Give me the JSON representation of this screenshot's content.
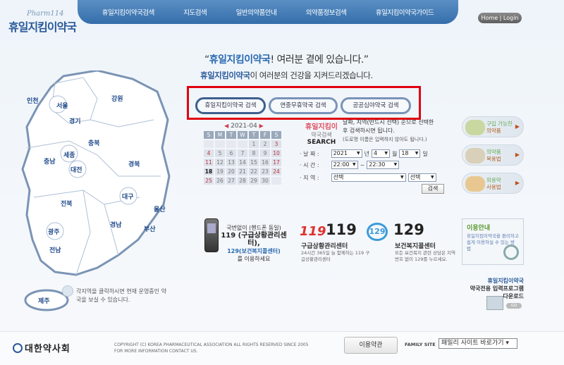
{
  "header": {
    "logo_sub": "Pharm114",
    "logo_main": "휴일지킴이약국",
    "nav": [
      "휴일지킴이약국검색",
      "지도검색",
      "일반의약품안내",
      "의약품정보검색",
      "휴일지킴이약국가이드"
    ],
    "home_login": "Home | Login"
  },
  "headline": {
    "line1_quote_open": "“",
    "line1_brand": "휴일지킴이약국",
    "line1_rest": "! 여러분 곁에 있습니다.",
    "line1_quote_close": "”",
    "line2_brand": "휴일지킴이약국",
    "line2_rest": "이 여러분의 건강을 지켜드리겠습니다."
  },
  "tabs": [
    "휴일지킴이약국 검색",
    "연중무휴약국 검색",
    "공공심야약국 검색"
  ],
  "calendar": {
    "title": "2021-04",
    "days": [
      "S",
      "M",
      "T",
      "W",
      "T",
      "F",
      "S"
    ],
    "cells": [
      "",
      "",
      "",
      "",
      "1",
      "2",
      "3",
      "4",
      "5",
      "6",
      "7",
      "8",
      "9",
      "10",
      "11",
      "12",
      "13",
      "14",
      "15",
      "16",
      "17",
      "18",
      "19",
      "20",
      "21",
      "22",
      "23",
      "24",
      "25",
      "26",
      "27",
      "28",
      "29",
      "30",
      ""
    ]
  },
  "search": {
    "label1": "휴일지킴이",
    "label2": "약국검색",
    "label3": "SEARCH",
    "desc1": "날짜, 지역(반드시 선택) 순으로 선택한",
    "desc2": "후 검색하시면 됩니다.",
    "desc3": "(도로명 이름은 입력하지 않아도 됩니다.)",
    "date_label": "· 날 짜 :",
    "year": "2021",
    "year_unit": "년",
    "month": "4",
    "month_unit": "월",
    "day": "18",
    "day_unit": "일",
    "time_label": "· 시 간 :",
    "time_from": "22:00",
    "time_sep": "~",
    "time_to": "22:30",
    "region_label": "· 지 역 :",
    "region1": "선택",
    "region2": "선택",
    "button": "검색"
  },
  "side_guides": [
    {
      "l1": "구입 가능한",
      "l2": "의약품"
    },
    {
      "l1": "의약품",
      "l2": "복용법"
    },
    {
      "l1": "외용약",
      "l2": "사용법"
    }
  ],
  "map": {
    "regions": [
      "인천",
      "서울",
      "강원",
      "경기",
      "충북",
      "충남",
      "세종",
      "대전",
      "경북",
      "대구",
      "전북",
      "울산",
      "경남",
      "부산",
      "광주",
      "전남",
      "제주"
    ],
    "note": "각지역을 클릭하시면 현재 운영중인 약국을 보실 수 있습니다."
  },
  "info": {
    "phone_l1": "국번없이 (핸드폰 동일)",
    "phone_l2": "119 (구급상황관리센터),",
    "phone_l3": "129(보건복지콜센터)",
    "phone_l4": "를 이용하세요",
    "logo119": "119",
    "num119": "119",
    "center119": "구급상황관리센터",
    "desc119": "24시간 365일 늘 함께하는 119 구급상황관리센터",
    "logo129": "129",
    "num129": "129",
    "center129": "보건복지콜센터",
    "desc129": "모든 보건복지 관련 상담은 지역번호 없이 129를 누르세요."
  },
  "guide": {
    "title": "이용안내",
    "desc": "휴일지킴이약국을 편리하고 쉽게 이용하실 수 있는 방법",
    "agent_l1": "휴일지킴이약국",
    "agent_l2": "약국전용 입력프로그램",
    "agent_l3": "다운로드",
    "go": "GO"
  },
  "footer": {
    "kpa": "대한약사회",
    "copy1": "COPYRIGHT (C) KOREA PHARMACEUTICAL ASSOCIATION ALL RIGHTS RESERVED SINCE 2005",
    "copy2": "FOR MORE INFORMATION CONTACT US.",
    "terms": "이용약관",
    "family_label": "FAMILY SITE",
    "family_select": "패밀리 사이트 바로가기"
  },
  "colors": {
    "brand_blue": "#2a5a9a",
    "nav_blue": "#3e76b0",
    "highlight_red": "#e00010",
    "accent_green": "#5a9a30"
  }
}
